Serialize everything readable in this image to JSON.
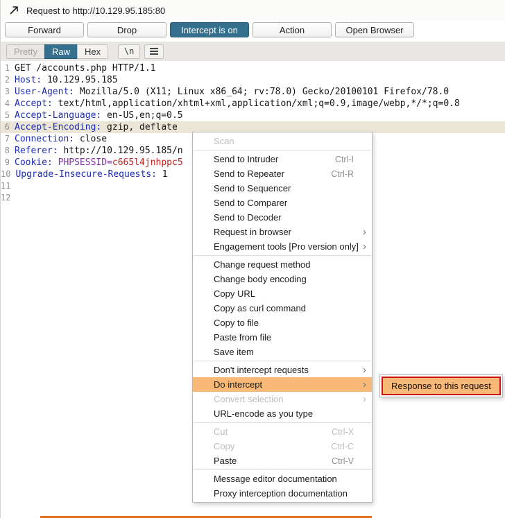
{
  "colors": {
    "accent_blue": "#36708f",
    "menu_highlight_orange": "#f8b878",
    "selection_red": "#cc1414",
    "line_highlight": "#ebe5d6",
    "header_key_blue": "#1d2db4",
    "cookie_name_purple": "#8033a8",
    "cookie_value_red": "#c41f1f",
    "bottom_bar_orange": "#e2701f"
  },
  "titlebar": {
    "title": "Request to http://10.129.95.185:80"
  },
  "toolbar": {
    "buttons": [
      {
        "label": "Forward",
        "active": false
      },
      {
        "label": "Drop",
        "active": false
      },
      {
        "label": "Intercept is on",
        "active": true
      },
      {
        "label": "Action",
        "active": false
      },
      {
        "label": "Open Browser",
        "active": false
      }
    ]
  },
  "view_tabs": {
    "tabs": [
      {
        "label": "Pretty",
        "state": "disabled"
      },
      {
        "label": "Raw",
        "state": "selected"
      },
      {
        "label": "Hex",
        "state": "normal"
      }
    ],
    "newline_label": "\\n"
  },
  "request": {
    "lines": [
      {
        "num": "1",
        "highlight": false,
        "segments": [
          {
            "type": "plain",
            "text": "GET /accounts.php HTTP/1.1"
          }
        ]
      },
      {
        "num": "2",
        "highlight": false,
        "segments": [
          {
            "type": "key",
            "text": "Host:"
          },
          {
            "type": "plain",
            "text": " 10.129.95.185"
          }
        ]
      },
      {
        "num": "3",
        "highlight": false,
        "segments": [
          {
            "type": "key",
            "text": "User-Agent:"
          },
          {
            "type": "plain",
            "text": " Mozilla/5.0 (X11; Linux x86_64; rv:78.0) Gecko/20100101 Firefox/78.0"
          }
        ]
      },
      {
        "num": "4",
        "highlight": false,
        "segments": [
          {
            "type": "key",
            "text": "Accept:"
          },
          {
            "type": "plain",
            "text": " text/html,application/xhtml+xml,application/xml;q=0.9,image/webp,*/*;q=0.8"
          }
        ]
      },
      {
        "num": "5",
        "highlight": false,
        "segments": [
          {
            "type": "key",
            "text": "Accept-Language:"
          },
          {
            "type": "plain",
            "text": " en-US,en;q=0.5"
          }
        ]
      },
      {
        "num": "6",
        "highlight": true,
        "segments": [
          {
            "type": "key",
            "text": "Accept-Encoding:"
          },
          {
            "type": "plain",
            "text": " gzip, deflate"
          }
        ]
      },
      {
        "num": "7",
        "highlight": false,
        "segments": [
          {
            "type": "key",
            "text": "Connection:"
          },
          {
            "type": "plain",
            "text": " close"
          }
        ]
      },
      {
        "num": "8",
        "highlight": false,
        "segments": [
          {
            "type": "key",
            "text": "Referer:"
          },
          {
            "type": "plain",
            "text": " http://10.129.95.185/n"
          }
        ]
      },
      {
        "num": "9",
        "highlight": false,
        "segments": [
          {
            "type": "key",
            "text": "Cookie:"
          },
          {
            "type": "plain",
            "text": " "
          },
          {
            "type": "cookie",
            "text": "PHPSESSID="
          },
          {
            "type": "red",
            "text": "c665l4jnhppc5"
          }
        ]
      },
      {
        "num": "10",
        "highlight": false,
        "segments": [
          {
            "type": "key",
            "text": "Upgrade-Insecure-Requests:"
          },
          {
            "type": "plain",
            "text": " 1"
          }
        ]
      },
      {
        "num": "11",
        "highlight": false,
        "segments": []
      },
      {
        "num": "12",
        "highlight": false,
        "segments": []
      }
    ]
  },
  "context_menu": {
    "items": [
      {
        "label": "Scan",
        "state": "disabled"
      },
      {
        "type": "separator"
      },
      {
        "label": "Send to Intruder",
        "shortcut": "Ctrl-I"
      },
      {
        "label": "Send to Repeater",
        "shortcut": "Ctrl-R"
      },
      {
        "label": "Send to Sequencer"
      },
      {
        "label": "Send to Comparer"
      },
      {
        "label": "Send to Decoder"
      },
      {
        "label": "Request in browser",
        "submenu": true
      },
      {
        "label": "Engagement tools [Pro version only]",
        "submenu": true
      },
      {
        "type": "separator"
      },
      {
        "label": "Change request method"
      },
      {
        "label": "Change body encoding"
      },
      {
        "label": "Copy URL"
      },
      {
        "label": "Copy as curl command"
      },
      {
        "label": "Copy to file"
      },
      {
        "label": "Paste from file"
      },
      {
        "label": "Save item"
      },
      {
        "type": "separator"
      },
      {
        "label": "Don't intercept requests",
        "submenu": true
      },
      {
        "label": "Do intercept",
        "submenu": true,
        "state": "highlighted"
      },
      {
        "label": "Convert selection",
        "submenu": true,
        "state": "disabled"
      },
      {
        "label": "URL-encode as you type"
      },
      {
        "type": "separator"
      },
      {
        "label": "Cut",
        "shortcut": "Ctrl-X",
        "state": "disabled"
      },
      {
        "label": "Copy",
        "shortcut": "Ctrl-C",
        "state": "disabled"
      },
      {
        "label": "Paste",
        "shortcut": "Ctrl-V"
      },
      {
        "type": "separator"
      },
      {
        "label": "Message editor documentation"
      },
      {
        "label": "Proxy interception documentation"
      }
    ]
  },
  "submenu": {
    "items": [
      {
        "label": "Response to this request",
        "highlighted": true
      }
    ]
  }
}
